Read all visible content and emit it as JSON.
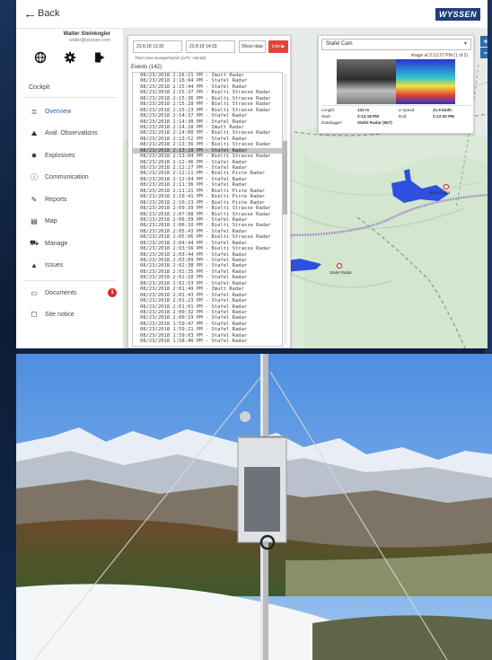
{
  "topbar": {
    "back_label": "Back",
    "brand": "WYSSEN"
  },
  "user": {
    "name": "Walter Steinkogler",
    "email": "walter@wyssen.com"
  },
  "sidebar": {
    "cockpit_label": "Cockpit",
    "items": [
      {
        "label": "Overview",
        "icon": "overview-icon",
        "active": true
      },
      {
        "label": "Aval. Observations",
        "icon": "avalanche-icon",
        "active": false
      },
      {
        "label": "Explosives",
        "icon": "explosion-icon",
        "active": false
      },
      {
        "label": "Communication",
        "icon": "info-icon",
        "active": false
      },
      {
        "label": "Reports",
        "icon": "edit-icon",
        "active": false
      },
      {
        "label": "Map",
        "icon": "map-icon",
        "active": false
      },
      {
        "label": "Manage",
        "icon": "truck-icon",
        "active": false
      },
      {
        "label": "Issues",
        "icon": "bell-icon",
        "active": false
      },
      {
        "label": "Documents",
        "icon": "documents-icon",
        "active": false,
        "badge": "1"
      },
      {
        "label": "Site notice",
        "icon": "notice-icon",
        "active": false
      }
    ]
  },
  "events": {
    "start_datetime": "23.8.18 13:32",
    "end_datetime": "23.8.18 14:33",
    "show_data_label": "Show data",
    "live_label": "Live ▶",
    "timezone_note": "Time zone Europe/Zurich (UTC +02:00)",
    "header": "Events (142)",
    "rows": [
      {
        "text": "08/23/2018 2:16:21 PM - Zmutt Radar",
        "selected": false
      },
      {
        "text": "08/23/2018 2:16:04 PM - Stafel Radar",
        "selected": false
      },
      {
        "text": "08/23/2018 2:15:44 PM - Stafel Radar",
        "selected": false
      },
      {
        "text": "08/23/2018 2:15:37 PM - Bielti Strasse Radar",
        "selected": false
      },
      {
        "text": "08/23/2018 2:15:36 PM - Bielti Strasse Radar",
        "selected": false
      },
      {
        "text": "08/23/2018 2:15:28 PM - Bielti Strasse Radar",
        "selected": false
      },
      {
        "text": "08/23/2018 2:15:23 PM - Bielti Strasse Radar",
        "selected": false
      },
      {
        "text": "08/23/2018 2:14:37 PM - Stafel Radar",
        "selected": false
      },
      {
        "text": "08/23/2018 2:14:30 PM - Stafel Radar",
        "selected": false
      },
      {
        "text": "08/23/2018 2:14:28 PM - Zmutt Radar",
        "selected": false
      },
      {
        "text": "08/23/2018 2:14:00 PM - Bielti Strasse Radar",
        "selected": false
      },
      {
        "text": "08/23/2018 2:13:52 PM - Stafel Radar",
        "selected": false
      },
      {
        "text": "08/23/2018 2:13:36 PM - Bielti Strasse Radar",
        "selected": false
      },
      {
        "text": "08/23/2018 2:13:18 PM - Stafel Radar",
        "selected": true
      },
      {
        "text": "08/23/2018 2:13:04 PM - Bielti Strasse Radar",
        "selected": false
      },
      {
        "text": "08/23/2018 2:12:46 PM - Stafel Radar",
        "selected": false
      },
      {
        "text": "08/23/2018 2:12:27 PM - Stafel Radar",
        "selected": false
      },
      {
        "text": "08/23/2018 2:12:11 PM - Bielti Piste Radar",
        "selected": false
      },
      {
        "text": "08/23/2018 2:12:04 PM - Stafel Radar",
        "selected": false
      },
      {
        "text": "08/23/2018 2:11:36 PM - Stafel Radar",
        "selected": false
      },
      {
        "text": "08/23/2018 2:11:21 PM - Bielti Piste Radar",
        "selected": false
      },
      {
        "text": "08/23/2018 2:10:41 PM - Bielti Piste Radar",
        "selected": false
      },
      {
        "text": "08/23/2018 2:10:23 PM - Bielti Piste Radar",
        "selected": false
      },
      {
        "text": "08/23/2018 2:09:39 PM - Bielti Strasse Radar",
        "selected": false
      },
      {
        "text": "08/23/2018 2:07:08 PM - Bielti Strasse Radar",
        "selected": false
      },
      {
        "text": "08/23/2018 2:06:39 PM - Stafel Radar",
        "selected": false
      },
      {
        "text": "08/23/2018 2:06:10 PM - Bielti Strasse Radar",
        "selected": false
      },
      {
        "text": "08/23/2018 2:05:43 PM - Stafel Radar",
        "selected": false
      },
      {
        "text": "08/23/2018 2:05:06 PM - Bielti Strasse Radar",
        "selected": false
      },
      {
        "text": "08/23/2018 2:04:44 PM - Stafel Radar",
        "selected": false
      },
      {
        "text": "08/23/2018 2:03:56 PM - Bielti Strasse Radar",
        "selected": false
      },
      {
        "text": "08/23/2018 2:03:44 PM - Stafel Radar",
        "selected": false
      },
      {
        "text": "08/23/2018 2:03:09 PM - Stafel Radar",
        "selected": false
      },
      {
        "text": "08/23/2018 2:02:38 PM - Stafel Radar",
        "selected": false
      },
      {
        "text": "08/23/2018 2:02:35 PM - Stafel Radar",
        "selected": false
      },
      {
        "text": "08/23/2018 2:02:10 PM - Stafel Radar",
        "selected": false
      },
      {
        "text": "08/23/2018 2:01:53 PM - Stafel Radar",
        "selected": false
      },
      {
        "text": "08/23/2018 2:01:49 PM - Zmutt Radar",
        "selected": false
      },
      {
        "text": "08/23/2018 2:01:43 PM - Stafel Radar",
        "selected": false
      },
      {
        "text": "08/23/2018 2:01:23 PM - Stafel Radar",
        "selected": false
      },
      {
        "text": "08/23/2018 2:01:01 PM - Stafel Radar",
        "selected": false
      },
      {
        "text": "08/23/2018 2:00:32 PM - Stafel Radar",
        "selected": false
      },
      {
        "text": "08/23/2018 2:00:19 PM - Stafel Radar",
        "selected": false
      },
      {
        "text": "08/23/2018 1:59:47 PM - Stafel Radar",
        "selected": false
      },
      {
        "text": "08/23/2018 1:59:21 PM - Stafel Radar",
        "selected": false
      },
      {
        "text": "08/23/2018 1:59:03 PM - Stafel Radar",
        "selected": false
      },
      {
        "text": "08/23/2018 1:58:40 PM - Stafel Radar",
        "selected": false
      }
    ]
  },
  "camera": {
    "selected": "Stafel Cam",
    "image_info": "image at 2:13:27 PM (1 of 2)",
    "stats": {
      "length_label": "Length:",
      "length_value": "133 m",
      "speed_label": "ø Speed:",
      "speed_value": "21.9 km/h",
      "start_label": "Start:",
      "start_value": "2:13:18 PM",
      "end_label": "End:",
      "end_value": "2:13:20 PM",
      "datalogger_label": "Datalogger:",
      "datalogger_value": "Stafel Radar (557)"
    }
  },
  "map": {
    "zoom_in": "+",
    "zoom_out": "−",
    "labels": [
      "Bielti Radar",
      "Stafel Radar"
    ]
  },
  "colors": {
    "accent": "#2b5ea8",
    "live": "#e0443a",
    "badge": "#d42b2b",
    "map_bg": "#dcebd9",
    "sky": "#69a3e6"
  }
}
